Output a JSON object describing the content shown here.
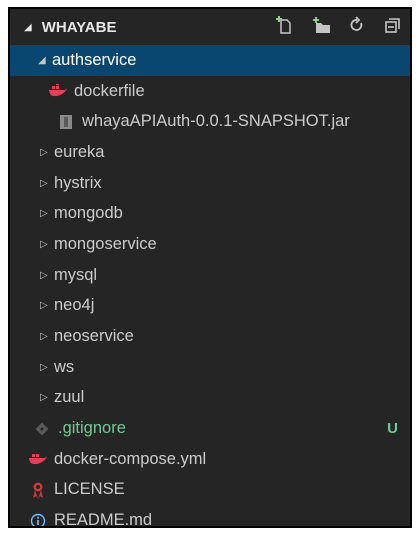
{
  "explorer": {
    "section_title": "WHAYABE",
    "section_twisty": "◢",
    "colors": {
      "background": "#252526",
      "selection": "#094771",
      "text": "#cccccc",
      "git_untracked": "#73c991",
      "docker": "#e2415b",
      "license": "#c83c3c",
      "info": "#75beff"
    },
    "actions": [
      {
        "name": "new-file-icon"
      },
      {
        "name": "new-folder-icon"
      },
      {
        "name": "refresh-icon"
      },
      {
        "name": "collapse-all-icon"
      }
    ],
    "tree": [
      {
        "label": "authservice",
        "type": "folder",
        "expanded": true,
        "selected": true
      },
      {
        "label": "dockerfile",
        "type": "docker"
      },
      {
        "label": "whayaAPIAuth-0.0.1-SNAPSHOT.jar",
        "type": "jar"
      },
      {
        "label": "eureka",
        "type": "folder"
      },
      {
        "label": "hystrix",
        "type": "folder"
      },
      {
        "label": "mongodb",
        "type": "folder"
      },
      {
        "label": "mongoservice",
        "type": "folder"
      },
      {
        "label": "mysql",
        "type": "folder"
      },
      {
        "label": "neo4j",
        "type": "folder"
      },
      {
        "label": "neoservice",
        "type": "folder"
      },
      {
        "label": "ws",
        "type": "folder"
      },
      {
        "label": "zuul",
        "type": "folder"
      },
      {
        "label": ".gitignore",
        "type": "git",
        "badge": "U"
      },
      {
        "label": "docker-compose.yml",
        "type": "docker"
      },
      {
        "label": "LICENSE",
        "type": "license"
      },
      {
        "label": "README.md",
        "type": "info"
      }
    ]
  }
}
